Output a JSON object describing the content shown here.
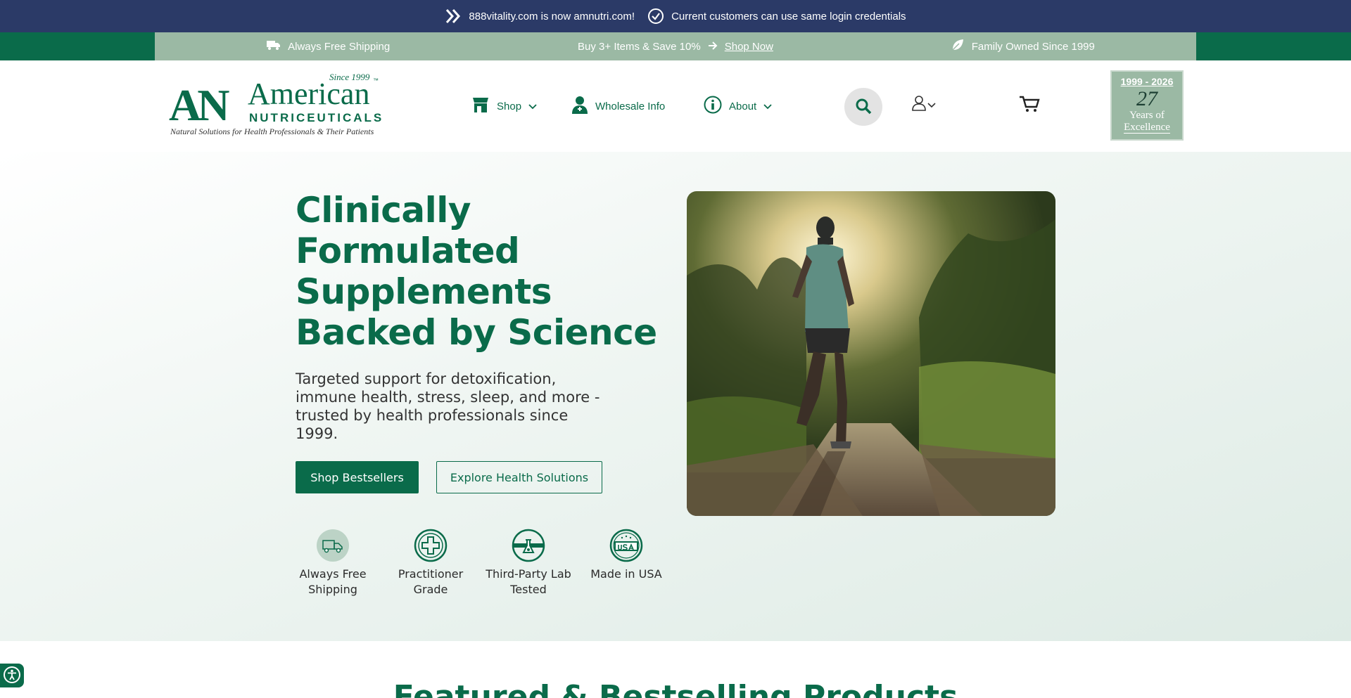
{
  "topbar": {
    "domain_notice": "888vitality.com is now amnutri.com!",
    "login_notice": "Current customers can use same login credentials"
  },
  "promobar": {
    "shipping": "Always Free Shipping",
    "deal": "Buy 3+ Items & Save 10%",
    "shop_now": "Shop Now",
    "family": "Family Owned Since 1999"
  },
  "logo": {
    "mark": "AN",
    "american": "American",
    "nutriceuticals": "NUTRICEUTICALS",
    "since": "Since 1999",
    "tm": "™",
    "tagline": "Natural Solutions for Health Professionals & Their Patients"
  },
  "nav": {
    "shop": "Shop",
    "wholesale": "Wholesale Info",
    "about": "About"
  },
  "badge": {
    "years_range": "1999 - 2026",
    "count": "27",
    "line1": "Years of",
    "line2": "Excellence"
  },
  "hero": {
    "title": "Clinically Formulated Supplements Backed by Science",
    "subtitle": "Targeted support for detoxification, immune health, stress, sleep, and more - trusted by health professionals since 1999.",
    "primary_cta": "Shop Bestsellers",
    "secondary_cta": "Explore Health Solutions",
    "features": [
      {
        "label": "Always Free Shipping"
      },
      {
        "label": "Practitioner Grade"
      },
      {
        "label": "Third-Party Lab Tested"
      },
      {
        "label": "Made in USA"
      }
    ]
  },
  "featured": {
    "title": "Featured & Bestselling Products"
  },
  "colors": {
    "navy": "#2b3a67",
    "brand_green": "#0a6b4a",
    "sage": "#9bb9a4"
  },
  "icons": {
    "topbar_left": "double-chevron-right-icon",
    "topbar_right": "check-circle-icon",
    "shipping": "truck-icon",
    "deal": "arrow-right-icon",
    "family": "leaf-icon",
    "shop": "store-icon",
    "wholesale": "doctor-icon",
    "about": "info-icon",
    "search": "search-icon",
    "account": "user-icon",
    "cart": "cart-icon",
    "accessibility": "accessibility-icon"
  }
}
